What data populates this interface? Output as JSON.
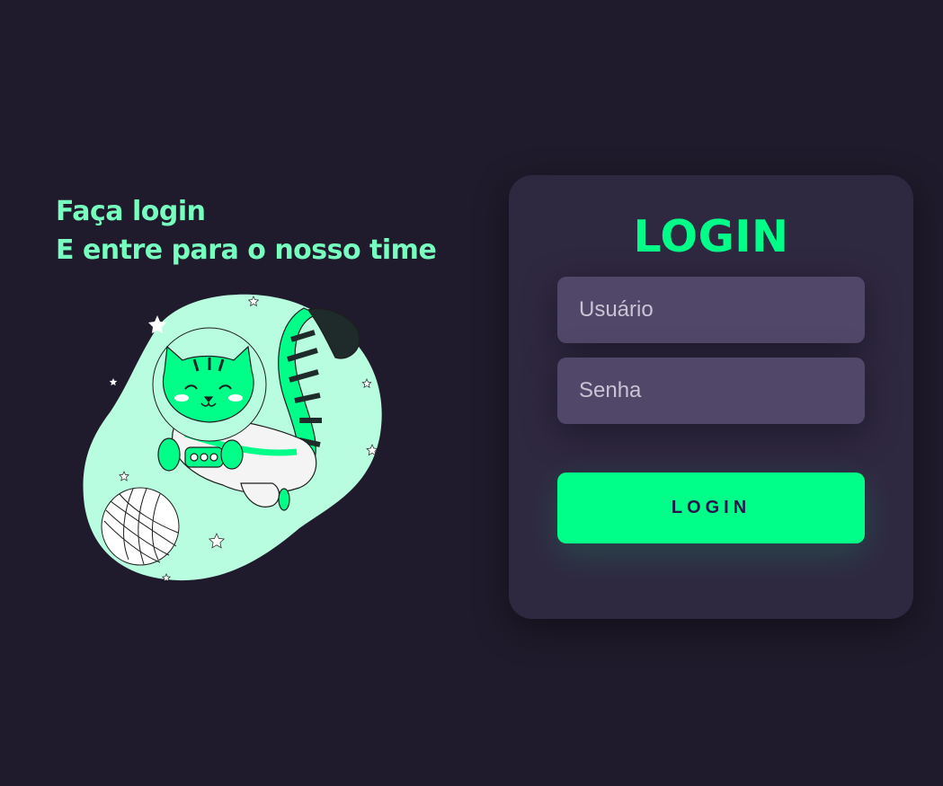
{
  "hero": {
    "line1": "Faça login",
    "line2": "E entre para o nosso time",
    "illustration_icon": "astronaut-cat-illustration"
  },
  "login_card": {
    "title": "LOGIN",
    "username_placeholder": "Usuário",
    "password_placeholder": "Senha",
    "submit_label": "LOGIN"
  },
  "colors": {
    "background": "#201b2c",
    "card": "#2f2841",
    "input": "#514869",
    "accent": "#00ff88",
    "headline": "#77ffc0",
    "button_text": "#2b134b"
  }
}
